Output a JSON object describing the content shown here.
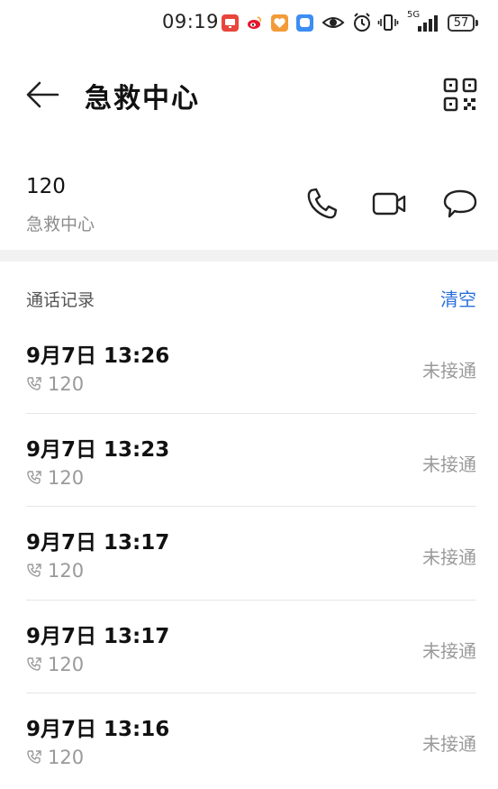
{
  "status_bar": {
    "time": "09:19",
    "battery": "57",
    "network": "5G",
    "icons": [
      "tv-app-icon",
      "weibo-icon",
      "heart-app-icon",
      "chat-app-icon",
      "eye-icon",
      "alarm-icon",
      "vibrate-icon",
      "signal-icon"
    ]
  },
  "header": {
    "title": "急救中心",
    "back_icon": "arrow-left-icon",
    "qr_icon": "qr-code-icon"
  },
  "contact": {
    "number": "120",
    "name": "急救中心",
    "actions": [
      "phone-icon",
      "video-call-icon",
      "message-icon"
    ]
  },
  "call_log": {
    "title": "通话记录",
    "clear_label": "清空",
    "entries": [
      {
        "time": "9月7日 13:26",
        "number": "120",
        "status": "未接通"
      },
      {
        "time": "9月7日 13:23",
        "number": "120",
        "status": "未接通"
      },
      {
        "time": "9月7日 13:17",
        "number": "120",
        "status": "未接通"
      },
      {
        "time": "9月7日 13:17",
        "number": "120",
        "status": "未接通"
      },
      {
        "time": "9月7日 13:16",
        "number": "120",
        "status": "未接通"
      }
    ]
  },
  "colors": {
    "accent": "#2a6fdb",
    "muted_text": "#9a9a9a",
    "divider": "#e6e6e6",
    "band": "#f2f2f2"
  }
}
